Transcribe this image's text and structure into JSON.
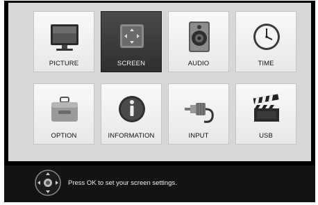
{
  "menu": {
    "items": [
      {
        "label": "PICTURE",
        "icon": "tv-icon",
        "selected": false
      },
      {
        "label": "SCREEN",
        "icon": "screen-adjust-icon",
        "selected": true
      },
      {
        "label": "AUDIO",
        "icon": "speaker-icon",
        "selected": false
      },
      {
        "label": "TIME",
        "icon": "clock-icon",
        "selected": false
      },
      {
        "label": "OPTION",
        "icon": "toolbox-icon",
        "selected": false
      },
      {
        "label": "INFORMATION",
        "icon": "info-icon",
        "selected": false
      },
      {
        "label": "INPUT",
        "icon": "rca-plug-icon",
        "selected": false
      },
      {
        "label": "USB",
        "icon": "clapperboard-icon",
        "selected": false
      }
    ]
  },
  "hint": {
    "icon": "remote-dpad-icon",
    "text": "Press OK to set your screen settings."
  },
  "colors": {
    "panel": "#d7d7d7",
    "tile": "#f2f2f2",
    "selected_tile": "#3c3c3c",
    "hint_bar": "#131313"
  }
}
